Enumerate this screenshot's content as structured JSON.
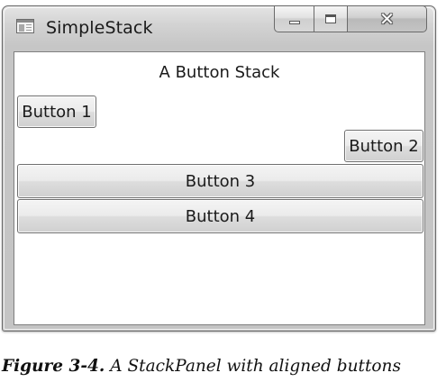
{
  "window": {
    "title": "SimpleStack",
    "icon": "window-app-icon",
    "caption_buttons": [
      {
        "name": "minimize",
        "icon": "minimize-icon"
      },
      {
        "name": "maximize",
        "icon": "maximize-icon"
      },
      {
        "name": "close",
        "icon": "close-icon",
        "glyph": "✕"
      }
    ]
  },
  "content": {
    "heading": "A Button Stack",
    "buttons": [
      {
        "label": "Button 1",
        "alignment": "left"
      },
      {
        "label": "Button 2",
        "alignment": "right"
      },
      {
        "label": "Button 3",
        "alignment": "stretch"
      },
      {
        "label": "Button 4",
        "alignment": "stretch"
      }
    ]
  },
  "figure_caption": {
    "label": "Figure 3-4.",
    "text": " A StackPanel with aligned buttons"
  },
  "colors": {
    "window_frame": "#c6c6c6",
    "client_background": "#ffffff",
    "text": "#1a1a1a"
  }
}
